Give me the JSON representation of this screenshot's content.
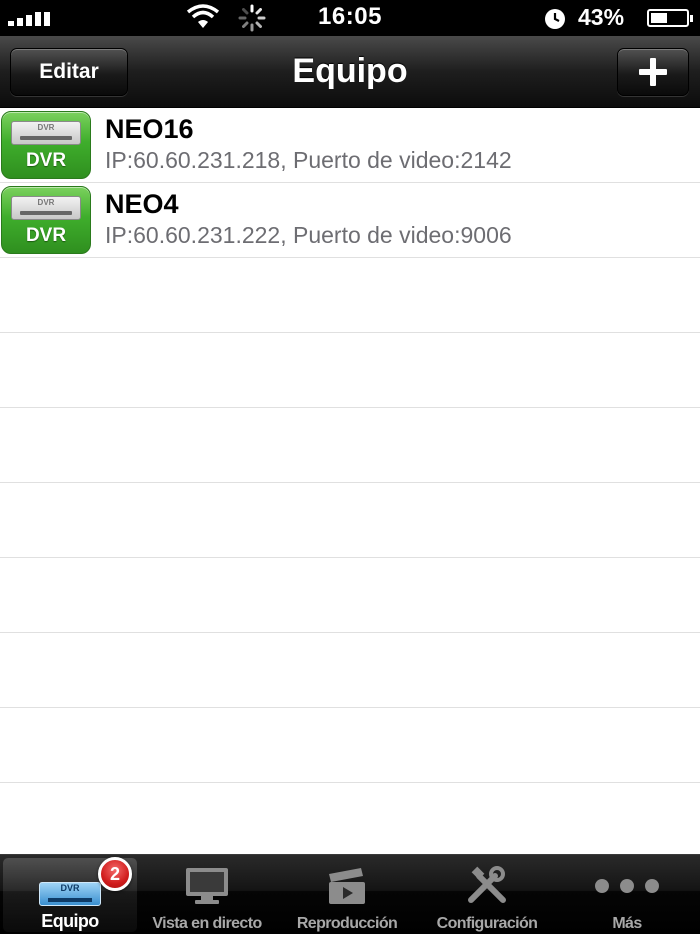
{
  "status_bar": {
    "time": "16:05",
    "battery_text": "43%",
    "battery_level": 0.43,
    "icons": [
      "signal-icon",
      "wifi-icon",
      "activity-spinner-icon",
      "clock-icon",
      "battery-icon"
    ]
  },
  "nav": {
    "title": "Equipo",
    "edit_label": "Editar",
    "add_icon": "plus-icon"
  },
  "devices": [
    {
      "icon_label": "DVR",
      "icon_mini": "DVR",
      "name": "NEO16",
      "detail": "IP:60.60.231.218, Puerto de video:2142"
    },
    {
      "icon_label": "DVR",
      "icon_mini": "DVR",
      "name": "NEO4",
      "detail": "IP:60.60.231.222, Puerto de video:9006"
    }
  ],
  "tabs": [
    {
      "label": "Equipo",
      "icon": "dvr-icon",
      "badge": "2",
      "active": true
    },
    {
      "label": "Vista en directo",
      "icon": "monitor-icon"
    },
    {
      "label": "Reproducción",
      "icon": "film-play-icon"
    },
    {
      "label": "Configuración",
      "icon": "tools-icon"
    },
    {
      "label": "Más",
      "icon": "more-dots-icon"
    }
  ],
  "colors": {
    "dvr_green": "#3fae2c",
    "nav_dark": "#1e1e1e",
    "badge_red": "#d11d1d",
    "subtitle_gray": "#6d6d72"
  }
}
